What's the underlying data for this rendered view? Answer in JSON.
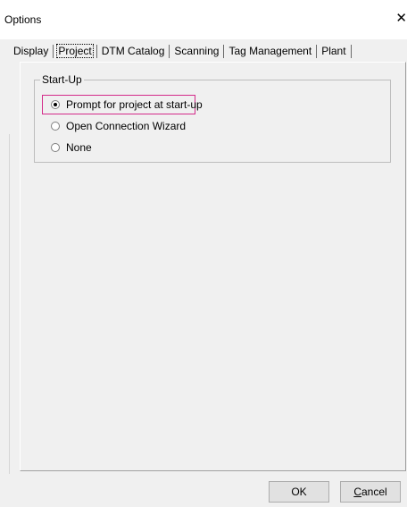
{
  "window": {
    "title": "Options",
    "close_glyph": "✕"
  },
  "tabs": [
    {
      "label": "Display",
      "active": false
    },
    {
      "label": "Project",
      "active": true
    },
    {
      "label": "DTM Catalog",
      "active": false
    },
    {
      "label": "Scanning",
      "active": false
    },
    {
      "label": "Tag Management",
      "active": false
    },
    {
      "label": "Plant",
      "active": false
    }
  ],
  "startup_group": {
    "legend": "Start-Up",
    "options": [
      {
        "label": "Prompt for project at start-up",
        "checked": true
      },
      {
        "label": "Open Connection Wizard",
        "checked": false
      },
      {
        "label": "None",
        "checked": false
      }
    ]
  },
  "buttons": {
    "ok_label": "OK",
    "cancel_first": "C",
    "cancel_rest": "ancel"
  },
  "colors": {
    "highlight": "#d42b8a",
    "background": "#f0f0f0"
  }
}
